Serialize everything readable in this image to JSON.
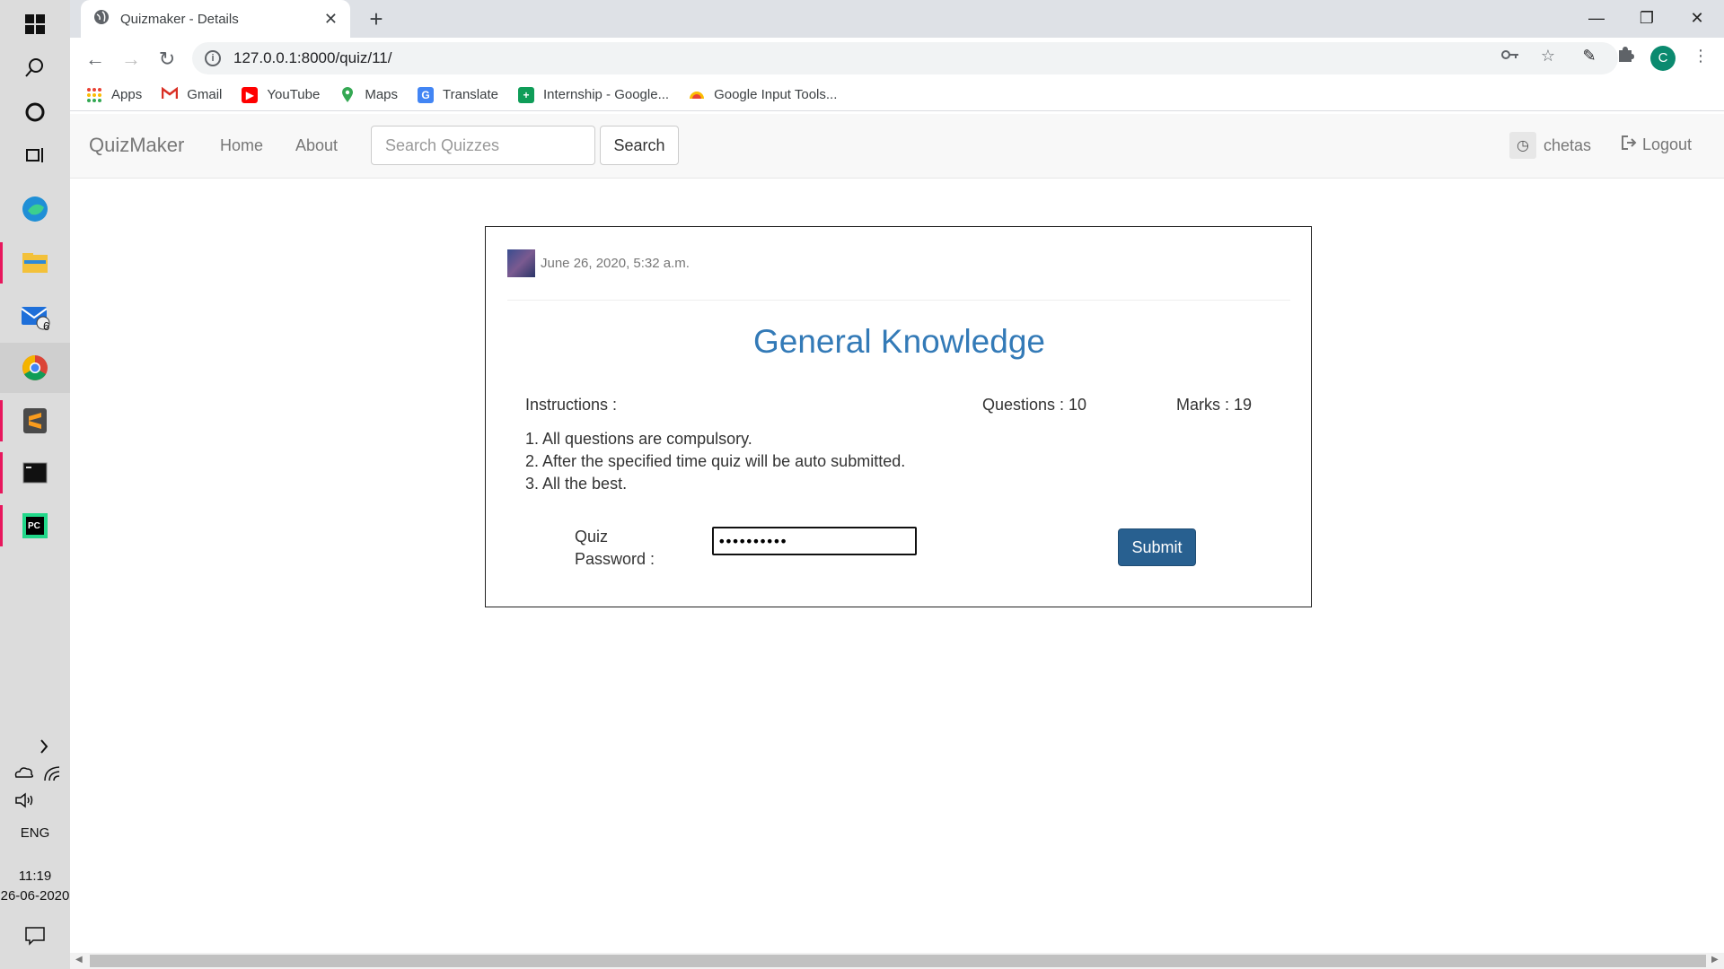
{
  "taskbar": {
    "mail_badge": "6",
    "lang": "ENG",
    "time": "11:19",
    "date": "26-06-2020"
  },
  "browser": {
    "tab_title": "Quizmaker - Details",
    "url": "127.0.0.1:8000/quiz/11/",
    "profile_initial": "C",
    "bookmarks": [
      {
        "label": "Apps",
        "color": "#ea4335"
      },
      {
        "label": "Gmail",
        "color": "#d93025"
      },
      {
        "label": "YouTube",
        "color": "#ff0000"
      },
      {
        "label": "Maps",
        "color": "#34a853"
      },
      {
        "label": "Translate",
        "color": "#4285f4"
      },
      {
        "label": "Internship - Google...",
        "color": "#0f9d58"
      },
      {
        "label": "Google Input Tools...",
        "color": "#fbbc04"
      }
    ]
  },
  "navbar": {
    "brand": "QuizMaker",
    "links": [
      "Home",
      "About"
    ],
    "search_placeholder": "Search Quizzes",
    "search_button": "Search",
    "user": "chetas",
    "logout": "Logout"
  },
  "quiz": {
    "date": "June 26, 2020, 5:32 a.m.",
    "title": "General Knowledge",
    "instructions_label": "Instructions :",
    "questions": "Questions : 10",
    "marks": "Marks : 19",
    "instructions": [
      "1. All questions are compulsory.",
      "2. After the specified time quiz will be auto submitted.",
      "3. All the best."
    ],
    "password_label_line1": "Quiz",
    "password_label_line2": "Password :",
    "password_value": "••••••••••",
    "submit": "Submit"
  },
  "colors": {
    "title_blue": "#337ab7",
    "submit_bg": "#286090"
  }
}
